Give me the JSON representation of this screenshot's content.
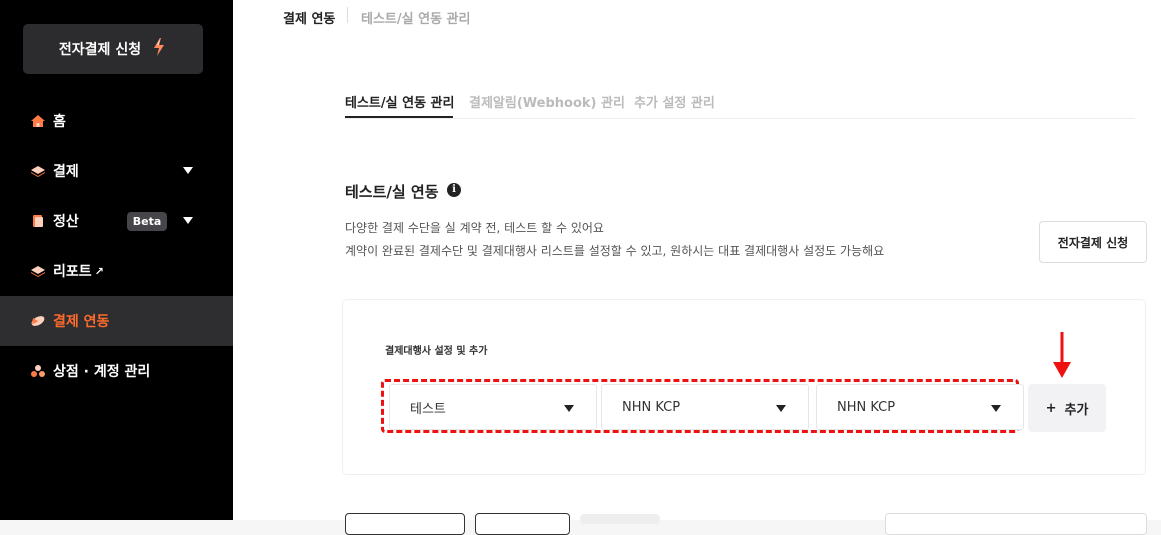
{
  "sidebar": {
    "apply_button": {
      "label": "전자결제 신청",
      "icon": "lightning-icon"
    },
    "items": [
      {
        "label": "홈",
        "icon": "home-icon"
      },
      {
        "label": "결제",
        "icon": "layers-icon",
        "has_dropdown": true
      },
      {
        "label": "정산",
        "icon": "document-icon",
        "badge": "Beta",
        "has_dropdown": true
      },
      {
        "label": "리포트",
        "icon": "layers-icon",
        "external": "↗"
      },
      {
        "label": "결제 연동",
        "icon": "pill-icon",
        "active": true
      },
      {
        "label": "상점 · 계정 관리",
        "icon": "store-icon"
      }
    ]
  },
  "breadcrumb": {
    "first": "결제 연동",
    "second": "테스트/실 연동 관리"
  },
  "tabs": [
    {
      "label": "테스트/실 연동 관리",
      "active": true
    },
    {
      "label": "결제알림(Webhook) 관리",
      "active": false
    },
    {
      "label": "추가 설정 관리",
      "active": false
    }
  ],
  "section": {
    "title": "테스트/실 연동",
    "info_icon": "i",
    "desc_line1": "다양한 결제 수단을 실 계약 전, 테스트 할 수 있어요",
    "desc_line2": "계약이 완료된 결제수단 및 결제대행사 리스트를 설정할 수 있고, 원하시는 대표 결제대행사 설정도 가능해요",
    "apply_button": "전자결제 신청"
  },
  "panel": {
    "label": "결제대행사 설정 및 추가",
    "selects": [
      {
        "value": "테스트"
      },
      {
        "value": "NHN KCP"
      },
      {
        "value": "NHN KCP"
      }
    ],
    "add_button": {
      "icon": "+",
      "label": "추가"
    }
  },
  "colors": {
    "sidebar_bg": "#000000",
    "active_accent": "#ff6b2c",
    "annotation_red": "#e11111"
  }
}
